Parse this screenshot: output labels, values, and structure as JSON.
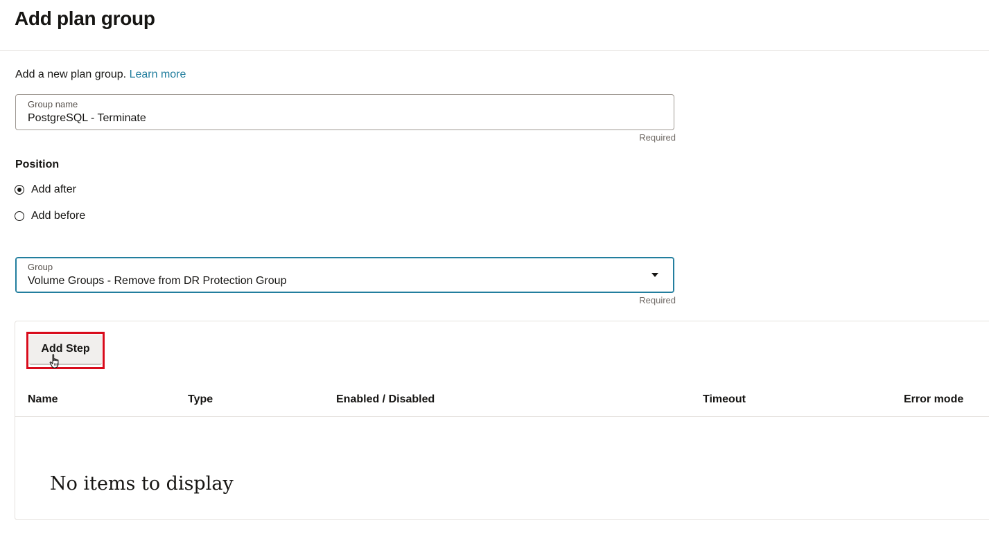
{
  "header": {
    "title": "Add plan group"
  },
  "intro": {
    "text": "Add a new plan group.",
    "link": "Learn more"
  },
  "group_name": {
    "label": "Group name",
    "value": "PostgreSQL - Terminate",
    "hint": "Required"
  },
  "position": {
    "label": "Position",
    "options": [
      {
        "label": "Add after",
        "checked": true
      },
      {
        "label": "Add before",
        "checked": false
      }
    ]
  },
  "group_select": {
    "label": "Group",
    "value": "Volume Groups - Remove from DR Protection Group",
    "hint": "Required"
  },
  "steps": {
    "add_button": "Add Step",
    "columns": [
      "Name",
      "Type",
      "Enabled / Disabled",
      "Timeout",
      "Error mode"
    ],
    "empty_text": "No items to display"
  },
  "colors": {
    "link": "#227e9e",
    "highlight": "#d80b1b",
    "focus": "#227e9e"
  }
}
